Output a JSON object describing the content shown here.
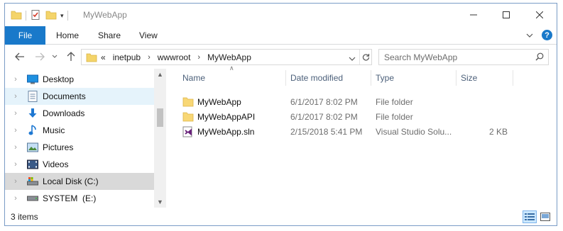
{
  "window": {
    "title": "MyWebApp"
  },
  "ribbon": {
    "tabs": [
      "File",
      "Home",
      "Share",
      "View"
    ],
    "accent": "#1979ca",
    "help_label": "?"
  },
  "nav": {
    "path": [
      "inetpub",
      "wwwroot",
      "MyWebApp"
    ],
    "overflow": "«",
    "search_placeholder": "Search MyWebApp"
  },
  "sidebar": {
    "items": [
      {
        "label": "Desktop",
        "icon": "desktop-icon",
        "state": "normal"
      },
      {
        "label": "Documents",
        "icon": "documents-icon",
        "state": "selected"
      },
      {
        "label": "Downloads",
        "icon": "downloads-icon",
        "state": "normal"
      },
      {
        "label": "Music",
        "icon": "music-icon",
        "state": "normal"
      },
      {
        "label": "Pictures",
        "icon": "pictures-icon",
        "state": "normal"
      },
      {
        "label": "Videos",
        "icon": "videos-icon",
        "state": "normal"
      },
      {
        "label": "Local Disk (C:)",
        "icon": "local-disk-icon",
        "state": "hover"
      },
      {
        "label": "SYSTEM  (E:)",
        "icon": "drive-icon",
        "state": "normal"
      }
    ]
  },
  "table": {
    "columns": [
      "Name",
      "Date modified",
      "Type",
      "Size"
    ],
    "rows": [
      {
        "name": "MyWebApp",
        "date": "6/1/2017 8:02 PM",
        "type": "File folder",
        "size": "",
        "icon": "folder-icon"
      },
      {
        "name": "MyWebAppAPI",
        "date": "6/1/2017 8:02 PM",
        "type": "File folder",
        "size": "",
        "icon": "folder-icon"
      },
      {
        "name": "MyWebApp.sln",
        "date": "2/15/2018 5:41 PM",
        "type": "Visual Studio Solu...",
        "size": "2 KB",
        "icon": "visual-studio-solution-icon"
      }
    ]
  },
  "status": {
    "item_count": "3 items"
  }
}
